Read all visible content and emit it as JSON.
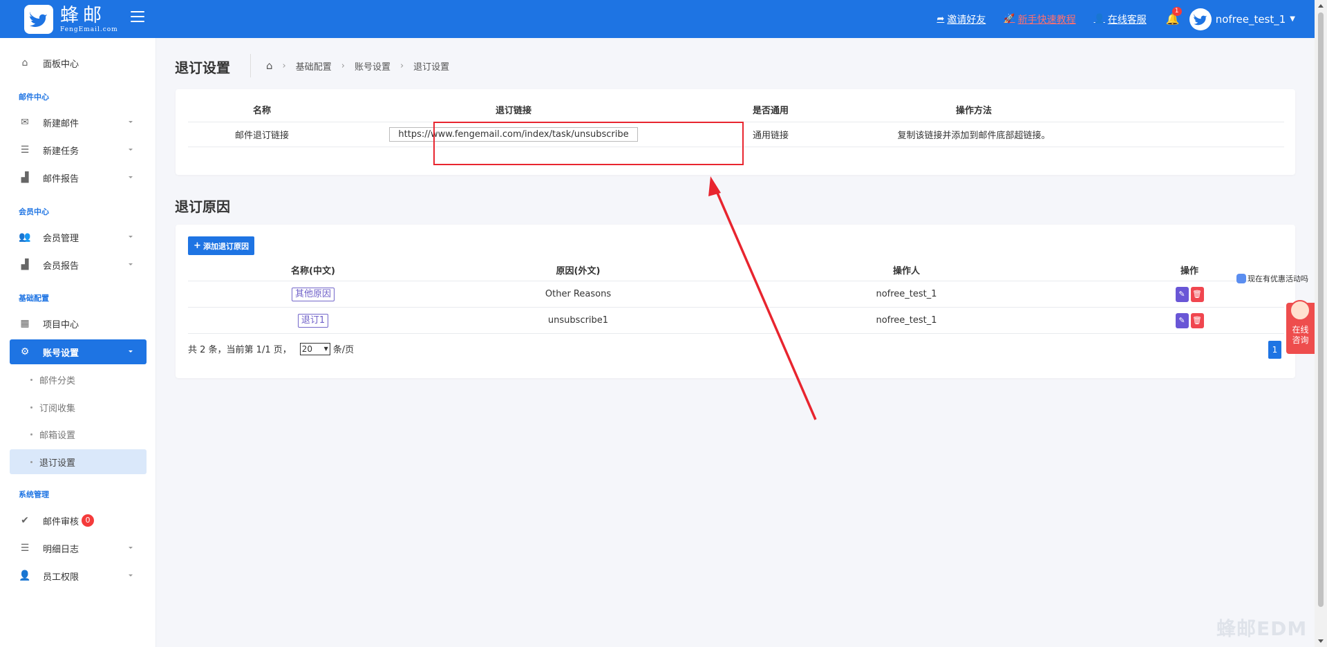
{
  "brand": {
    "name_cn": "蜂邮",
    "name_en": "FengEmail.com"
  },
  "topbar": {
    "links": [
      {
        "label": "邀请好友",
        "icon": "share-icon"
      },
      {
        "label": "新手快速教程",
        "icon": "rocket-icon"
      },
      {
        "label": "在线客服",
        "icon": "user-icon"
      }
    ],
    "notification_count": "1",
    "username": "nofree_test_1"
  },
  "sidebar": {
    "dashboard": "面板中心",
    "section_mail": "邮件中心",
    "new_mail": "新建邮件",
    "new_task": "新建任务",
    "mail_report": "邮件报告",
    "section_member": "会员中心",
    "member_mgmt": "会员管理",
    "member_report": "会员报告",
    "section_base": "基础配置",
    "project_center": "项目中心",
    "account_settings": "账号设置",
    "sub_items": [
      "邮件分类",
      "订阅收集",
      "邮箱设置",
      "退订设置"
    ],
    "section_system": "系统管理",
    "mail_review": "邮件审核",
    "mail_review_badge": "0",
    "detail_log": "明细日志",
    "staff_perm": "员工权限"
  },
  "header": {
    "title": "退订设置",
    "breadcrumb": [
      "基础配置",
      "账号设置",
      "退订设置"
    ]
  },
  "unsub_table": {
    "columns": [
      "名称",
      "退订链接",
      "是否通用",
      "操作方法"
    ],
    "row": {
      "name": "邮件退订链接",
      "link": "https://www.fengemail.com/index/task/unsubscribe",
      "general": "通用链接",
      "method": "复制该链接并添加到邮件底部超链接。"
    }
  },
  "reasons": {
    "title": "退订原因",
    "add_button": "添加退订原因",
    "columns": [
      "名称(中文)",
      "原因(外文)",
      "操作人",
      "操作"
    ],
    "rows": [
      {
        "name": "其他原因",
        "foreign": "Other Reasons",
        "operator": "nofree_test_1"
      },
      {
        "name": "退订1",
        "foreign": "unsubscribe1",
        "operator": "nofree_test_1"
      }
    ],
    "pager": {
      "summary": "共 2 条，当前第 1/1 页，",
      "page_size": "20",
      "per_page": "条/页",
      "current_page": "1"
    }
  },
  "float": {
    "promo": "现在有优惠活动吗",
    "consult": [
      "在线",
      "咨询"
    ]
  },
  "watermark": "蜂邮EDM",
  "colors": {
    "primary": "#1e74e3",
    "highlight": "#e8252f"
  }
}
